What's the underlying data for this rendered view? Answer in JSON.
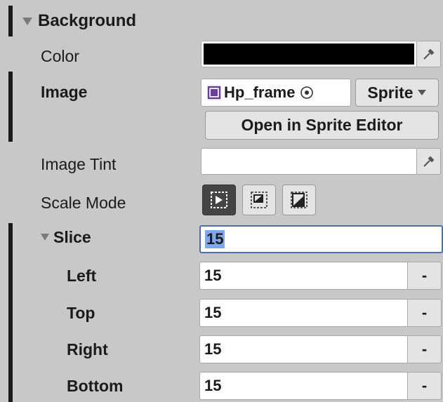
{
  "header": {
    "title": "Background"
  },
  "rows": {
    "color": {
      "label": "Color",
      "value_color": "#000000"
    },
    "image": {
      "label": "Image",
      "asset_name": "Hp_frame",
      "type_dropdown": "Sprite",
      "open_editor": "Open in Sprite Editor"
    },
    "image_tint": {
      "label": "Image Tint",
      "value_color": "#ffffff"
    },
    "scale_mode": {
      "label": "Scale Mode",
      "selected_index": 0
    },
    "slice": {
      "label": "Slice",
      "value": "15"
    },
    "left": {
      "label": "Left",
      "value": "15",
      "minus": "-"
    },
    "top": {
      "label": "Top",
      "value": "15",
      "minus": "-"
    },
    "right": {
      "label": "Right",
      "value": "15",
      "minus": "-"
    },
    "bottom": {
      "label": "Bottom",
      "value": "15",
      "minus": "-"
    }
  },
  "colors": {
    "panel_bg": "#c8c8c8",
    "override_bar": "#1a1a1a",
    "selection": "#7fa8ea",
    "focus_border": "#4a6fb3"
  }
}
